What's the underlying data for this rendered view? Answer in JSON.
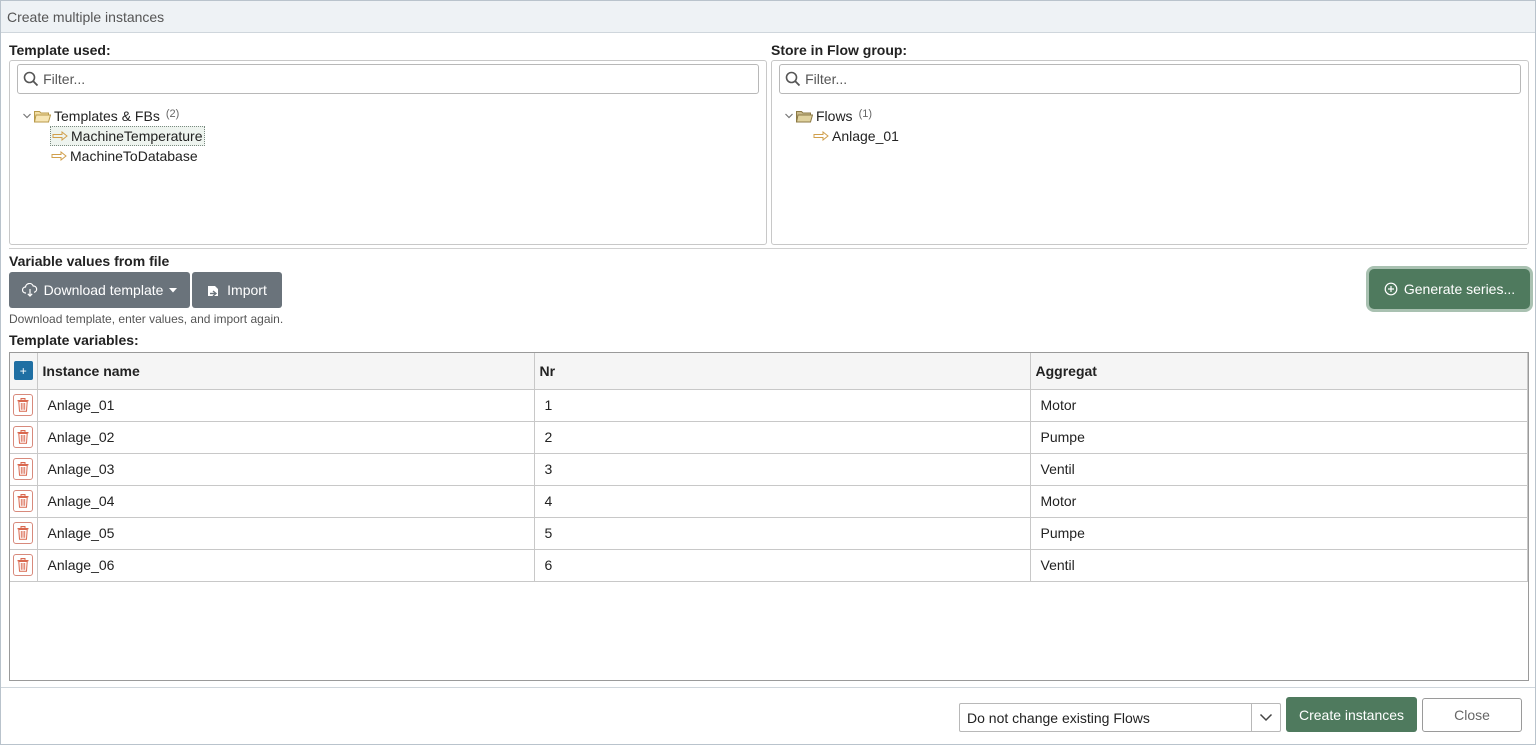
{
  "window": {
    "title": "Create multiple instances"
  },
  "template_panel": {
    "label": "Template used:",
    "filter_placeholder": "Filter...",
    "tree": {
      "folder": {
        "label": "Templates & FBs",
        "count": "(2)"
      },
      "items": [
        {
          "label": "MachineTemperature",
          "selected": true
        },
        {
          "label": "MachineToDatabase",
          "selected": false
        }
      ]
    }
  },
  "flow_panel": {
    "label": "Store in Flow group:",
    "filter_placeholder": "Filter...",
    "tree": {
      "folder": {
        "label": "Flows",
        "count": "(1)"
      },
      "items": [
        {
          "label": "Anlage_01"
        }
      ]
    }
  },
  "file_section": {
    "label": "Variable values from file",
    "download_label": "Download template",
    "import_label": "Import",
    "generate_label": "Generate series...",
    "hint": "Download template, enter values, and import again."
  },
  "variables": {
    "label": "Template variables:",
    "add_label": "+",
    "columns": [
      "Instance name",
      "Nr",
      "Aggregat"
    ],
    "rows": [
      [
        "Anlage_01",
        "1",
        "Motor"
      ],
      [
        "Anlage_02",
        "2",
        "Pumpe"
      ],
      [
        "Anlage_03",
        "3",
        "Ventil"
      ],
      [
        "Anlage_04",
        "4",
        "Motor"
      ],
      [
        "Anlage_05",
        "5",
        "Pumpe"
      ],
      [
        "Anlage_06",
        "6",
        "Ventil"
      ]
    ]
  },
  "footer": {
    "mode_value": "Do not change existing Flows",
    "create_label": "Create instances",
    "close_label": "Close"
  },
  "colors": {
    "accent_green": "#4f7a5e",
    "button_gray": "#6a737b",
    "add_blue": "#1f6fa3",
    "delete_red": "#d9684f"
  }
}
